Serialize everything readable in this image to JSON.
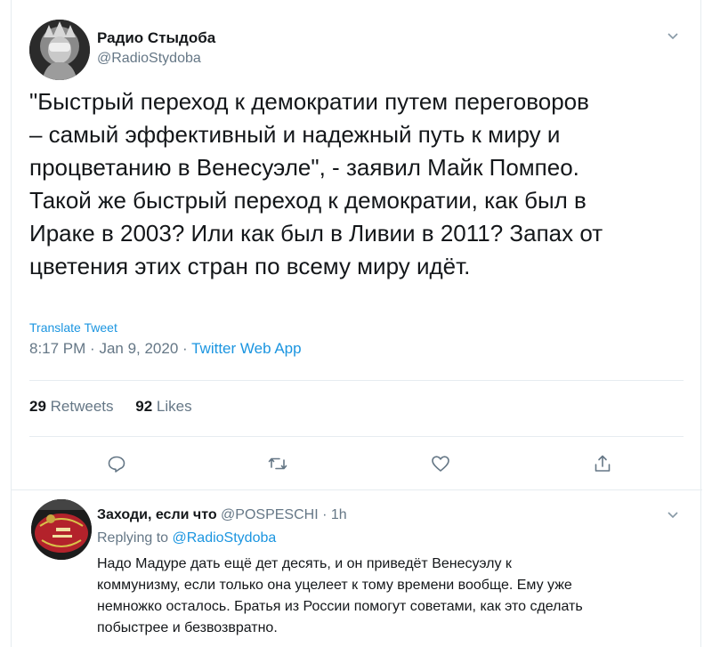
{
  "tweet": {
    "author_name": "Радио Стыдоба",
    "author_handle": "@RadioStydoba",
    "text": "\"Быстрый переход к демократии путем переговоров\n– самый эффективный и надежный путь к миру и\nпроцветанию в Венесуэле\", - заявил Майк Помпео.\nТакой же быстрый переход к демократии, как был в\nИраке в 2003? Или как был в Ливии в 2011? Запах от\nцветения этих стран по всему миру идёт.",
    "translate_label": "Translate Tweet",
    "time": "8:17 PM",
    "date": "Jan 9, 2020",
    "app": "Twitter Web App",
    "retweets_count": "29",
    "retweets_label": "Retweets",
    "likes_count": "92",
    "likes_label": "Likes"
  },
  "reply": {
    "author_name": "Заходи, если что",
    "author_handle": "@POSPESCHI",
    "time": "1h",
    "replying_label": "Replying to",
    "replying_to": "@RadioStydoba",
    "text": "Надо Мадуре дать ещё дет десять, и он приведёт Венесуэлу к\nкоммунизму, если только она уцелеет к тому времени вообще. Ему уже\nнемножко осталось. Братья из России помогут советами, как это сделать\nпобыстрее и безвозвратно."
  },
  "icons": {
    "reply": "reply-icon",
    "retweet": "retweet-icon",
    "like": "heart-icon",
    "share": "share-icon",
    "menu": "chevron-down-icon"
  },
  "colors": {
    "link": "#1b95e0",
    "secondary": "#657786",
    "text": "#14171a",
    "border": "#e6ecf0"
  }
}
